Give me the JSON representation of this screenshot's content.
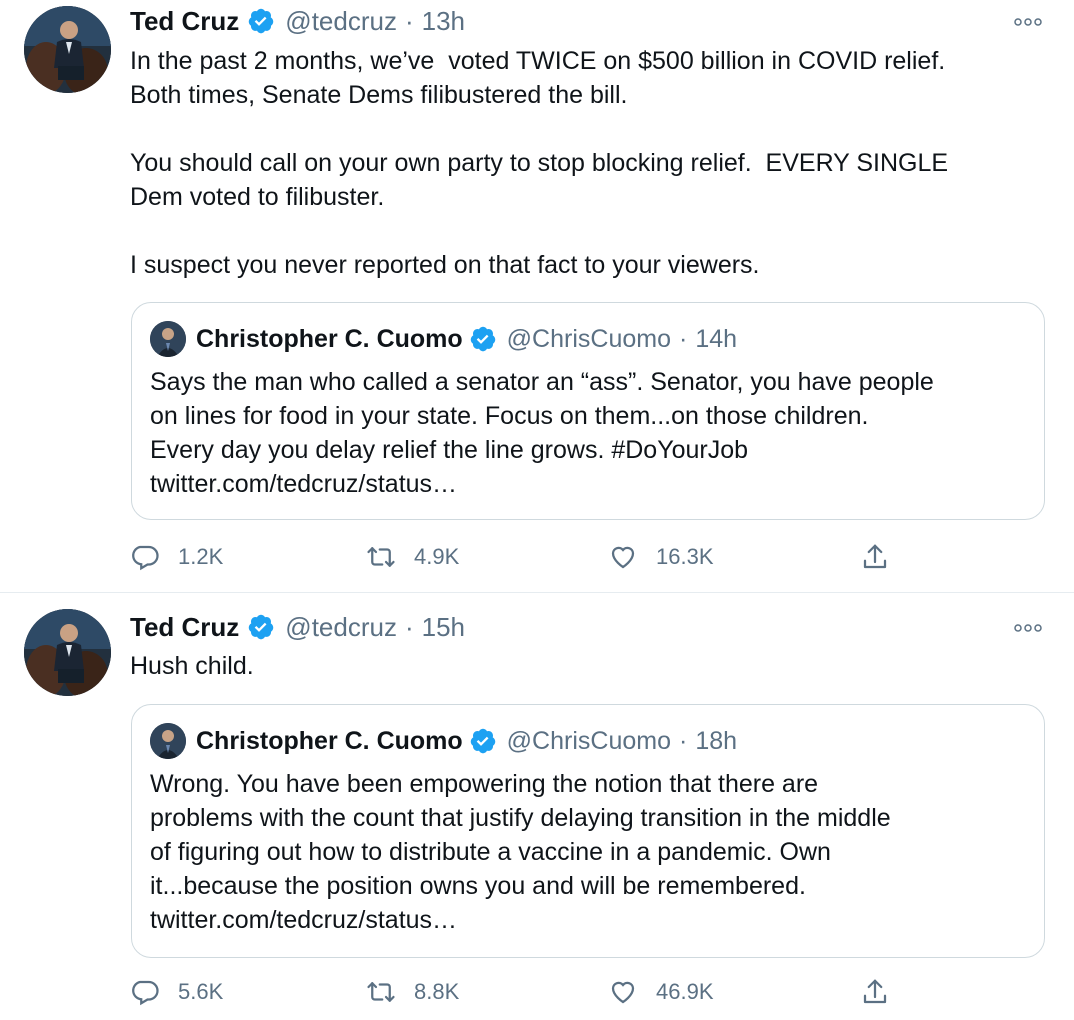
{
  "colors": {
    "text": "#0f1419",
    "muted": "#5b7083",
    "verified": "#1da1f2",
    "border": "#cfd9de"
  },
  "tweets": [
    {
      "author": {
        "name": "Ted Cruz",
        "handle": "@tedcruz",
        "time": "13h"
      },
      "separator": "·",
      "body": "In the past 2 months, we’ve  voted TWICE on $500 billion in COVID relief. \nBoth times, Senate Dems filibustered the bill.\n\nYou should call on your own party to stop blocking relief.  EVERY SINGLE \nDem voted to filibuster.\n\nI suspect you never reported on that fact to your viewers.",
      "quote": {
        "author": {
          "name": "Christopher C. Cuomo",
          "handle": "@ChrisCuomo",
          "time": "14h"
        },
        "separator": "·",
        "lines": [
          "Says the man who called a senator an “ass”. Senator, you have people",
          "on lines for food in your state. Focus on them...on those children.",
          "Every day you delay relief the line grows.  #DoYourJob",
          "twitter.com/tedcruz/status…"
        ]
      },
      "stats": {
        "replies": "1.2K",
        "retweets": "4.9K",
        "likes": "16.3K"
      }
    },
    {
      "author": {
        "name": "Ted Cruz",
        "handle": "@tedcruz",
        "time": "15h"
      },
      "separator": "·",
      "body": "Hush child.",
      "quote": {
        "author": {
          "name": "Christopher C. Cuomo",
          "handle": "@ChrisCuomo",
          "time": "18h"
        },
        "separator": "·",
        "lines": [
          "Wrong. You have been empowering the notion that there are",
          "problems with the count that justify delaying transition in the middle",
          "of figuring out how to distribute a vaccine in a pandemic. Own",
          "it...because the position owns you and will be remembered.",
          "twitter.com/tedcruz/status…"
        ]
      },
      "stats": {
        "replies": "5.6K",
        "retweets": "8.8K",
        "likes": "46.9K"
      }
    }
  ],
  "icons": {
    "verified": "verified-badge-icon",
    "more": "more-options-icon",
    "reply": "reply-icon",
    "retweet": "retweet-icon",
    "like": "heart-icon",
    "share": "share-icon"
  }
}
